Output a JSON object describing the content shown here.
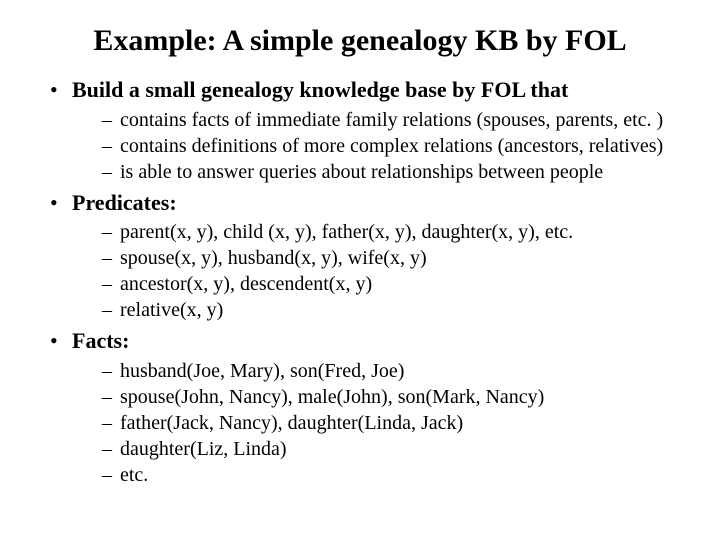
{
  "title": "Example: A simple genealogy KB by FOL",
  "bullets": [
    {
      "head": "Build a small genealogy knowledge base by FOL that",
      "subs": [
        "contains facts of immediate family relations (spouses, parents, etc. )",
        "contains definitions of more complex relations (ancestors, relatives)",
        "is able to answer queries about relationships between people"
      ]
    },
    {
      "head": "Predicates:",
      "subs": [
        "parent(x, y), child (x, y), father(x, y), daughter(x, y), etc.",
        "spouse(x, y), husband(x, y), wife(x, y)",
        "ancestor(x, y), descendent(x, y)",
        "relative(x, y)"
      ]
    },
    {
      "head": "Facts:",
      "subs": [
        "husband(Joe, Mary), son(Fred, Joe)",
        "spouse(John, Nancy), male(John), son(Mark, Nancy)",
        "father(Jack, Nancy), daughter(Linda, Jack)",
        "daughter(Liz, Linda)",
        "etc."
      ]
    }
  ]
}
